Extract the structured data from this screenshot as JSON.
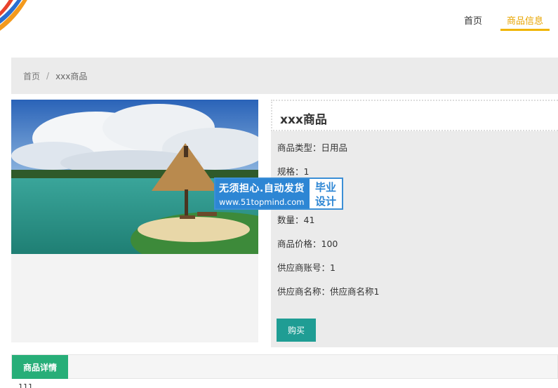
{
  "nav": {
    "items": [
      {
        "label": "首页"
      },
      {
        "label": "商品信息"
      }
    ]
  },
  "breadcrumb": {
    "home": "首页",
    "separator": "/",
    "current": "xxx商品"
  },
  "product": {
    "title": "xxx商品",
    "attributes": [
      {
        "key": "商品类型：",
        "value": "日用品"
      },
      {
        "key": "规格：",
        "value": "1"
      },
      {
        "key": "数量：",
        "value": "41"
      },
      {
        "key": "商品价格：",
        "value": "100"
      },
      {
        "key": "供应商账号：",
        "value": "1"
      },
      {
        "key": "供应商名称：",
        "value": "供应商名称1"
      }
    ],
    "buy_label": "购买"
  },
  "watermark": {
    "line1": "无须担心.自动发货",
    "line2": "www.51topmind.com",
    "right_top": "毕业",
    "right_bottom": "设计"
  },
  "tabs": {
    "active_label": "商品详情"
  },
  "detail": {
    "peek": "111"
  },
  "colors": {
    "accent_nav": "#f0b400",
    "buy_button": "#1f9d94",
    "tab_active": "#27ae78",
    "watermark_blue": "#2d86d4"
  }
}
